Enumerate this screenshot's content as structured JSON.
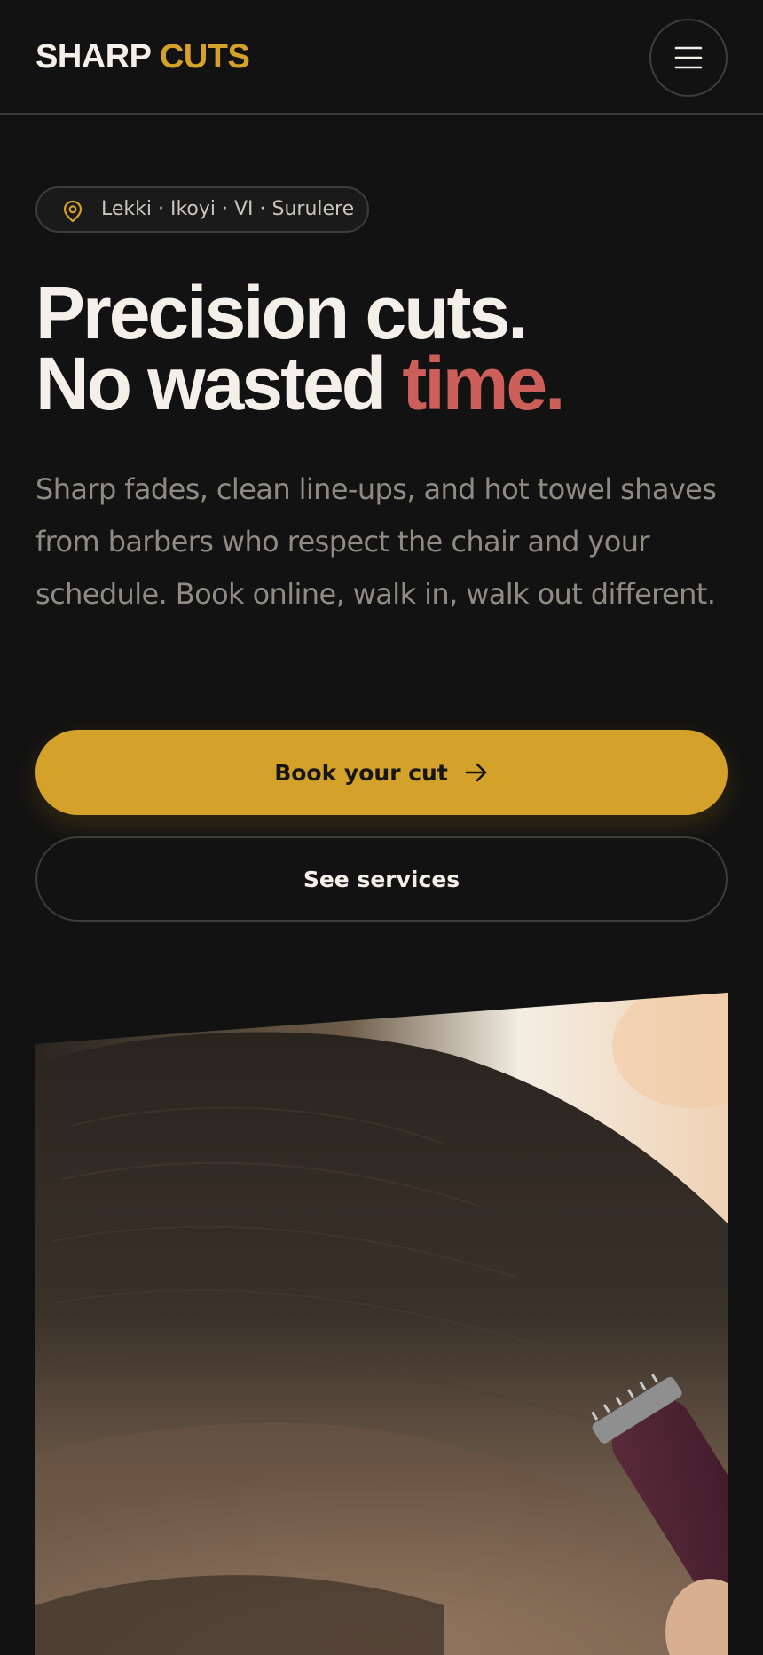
{
  "header": {
    "logo_primary": "SHARP",
    "logo_accent": "CUTS",
    "menu_icon": "hamburger-menu-icon"
  },
  "hero": {
    "locations": "Lekki · Ikoyi · VI · Surulere",
    "location_icon": "map-pin-icon",
    "headline_line1": "Precision cuts.",
    "headline_line2": "No wasted ",
    "headline_accent": "time.",
    "lead": "Sharp fades, clean line-ups, and hot towel shaves from barbers who respect the chair and your schedule. Book online, walk in, walk out different.",
    "primary_cta": "Book your cut",
    "primary_cta_icon": "arrow-right-icon",
    "secondary_cta": "See services",
    "image_subject": "Close-up of a skin fade haircut being trimmed with electric clippers"
  },
  "colors": {
    "background": "#121212",
    "text": "#f4efe8",
    "gold": "#d4a12a",
    "accent_red": "#cd5f5a",
    "muted": "#8f8b84"
  }
}
